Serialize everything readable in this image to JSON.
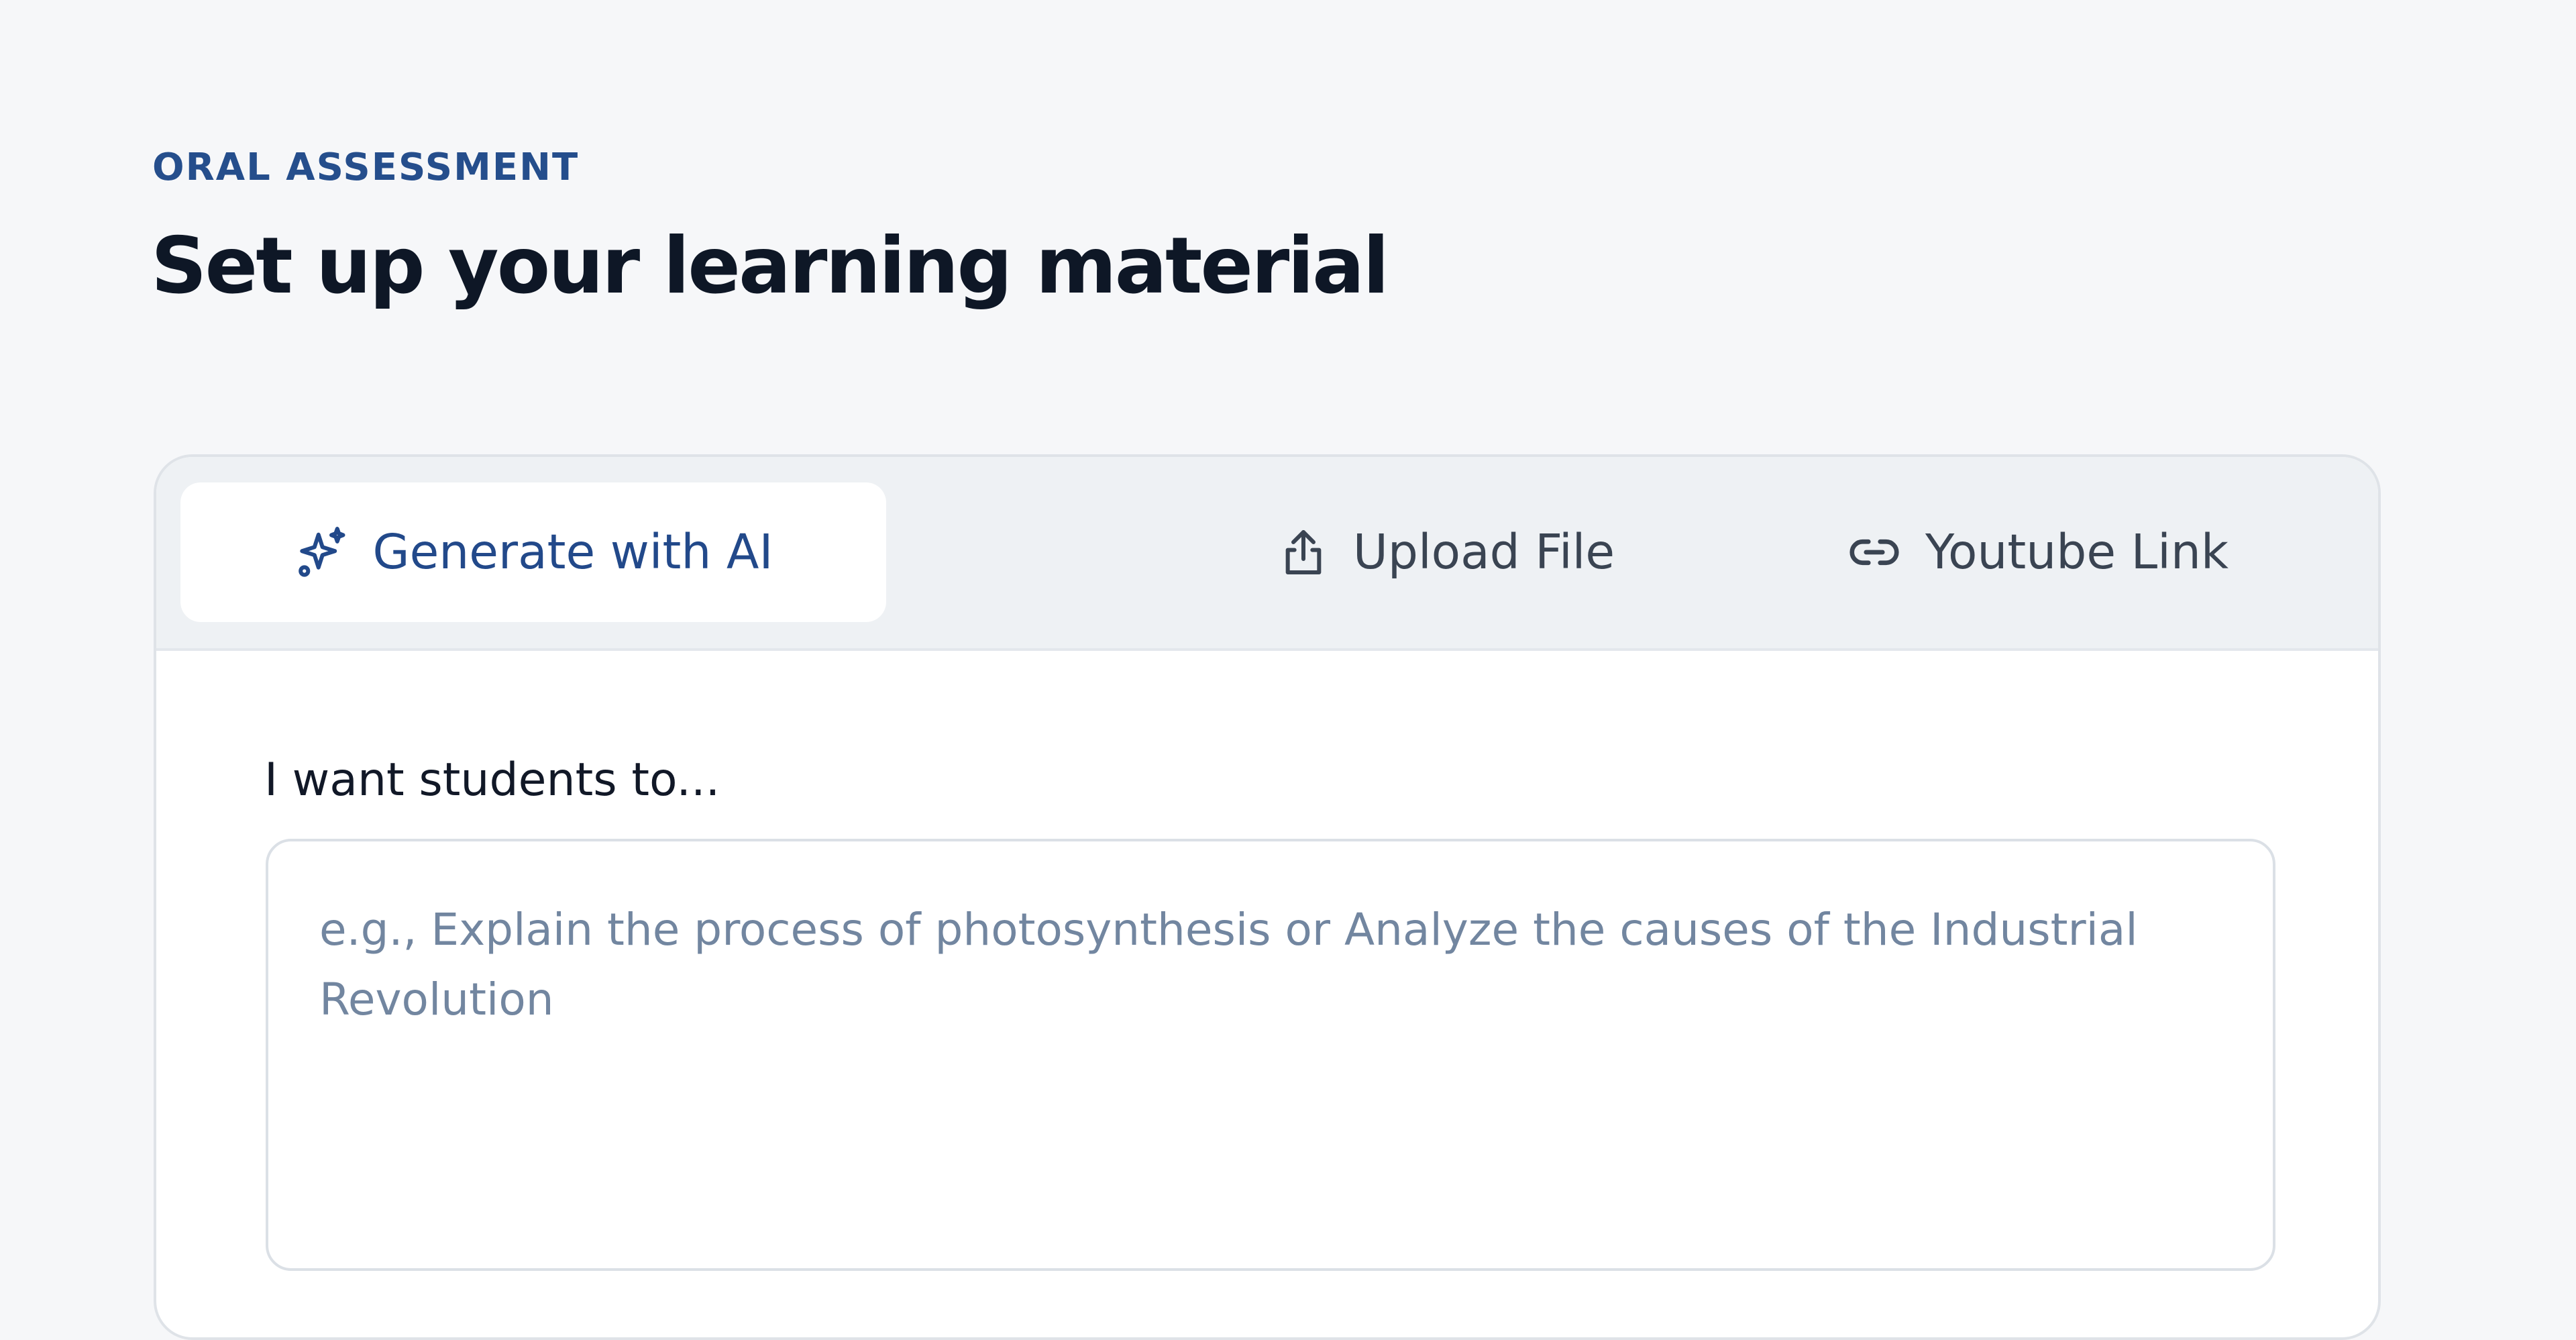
{
  "header": {
    "eyebrow": "ORAL ASSESSMENT",
    "title": "Set up your learning material"
  },
  "tabs": [
    {
      "label": "Generate with AI",
      "icon": "sparkles-icon",
      "active": true
    },
    {
      "label": "Upload File",
      "icon": "upload-icon",
      "active": false
    },
    {
      "label": "Youtube Link",
      "icon": "link-icon",
      "active": false
    }
  ],
  "form": {
    "label": "I want students to...",
    "value": "",
    "placeholder": "e.g., Explain the process of photosynthesis or Analyze the causes of the Industrial Revolution"
  },
  "colors": {
    "page_background": "#f6f7f9",
    "accent": "#254e8c",
    "tab_active_text": "#22498a",
    "tab_inactive_text": "#3a4452",
    "placeholder_text": "#7286a0"
  }
}
